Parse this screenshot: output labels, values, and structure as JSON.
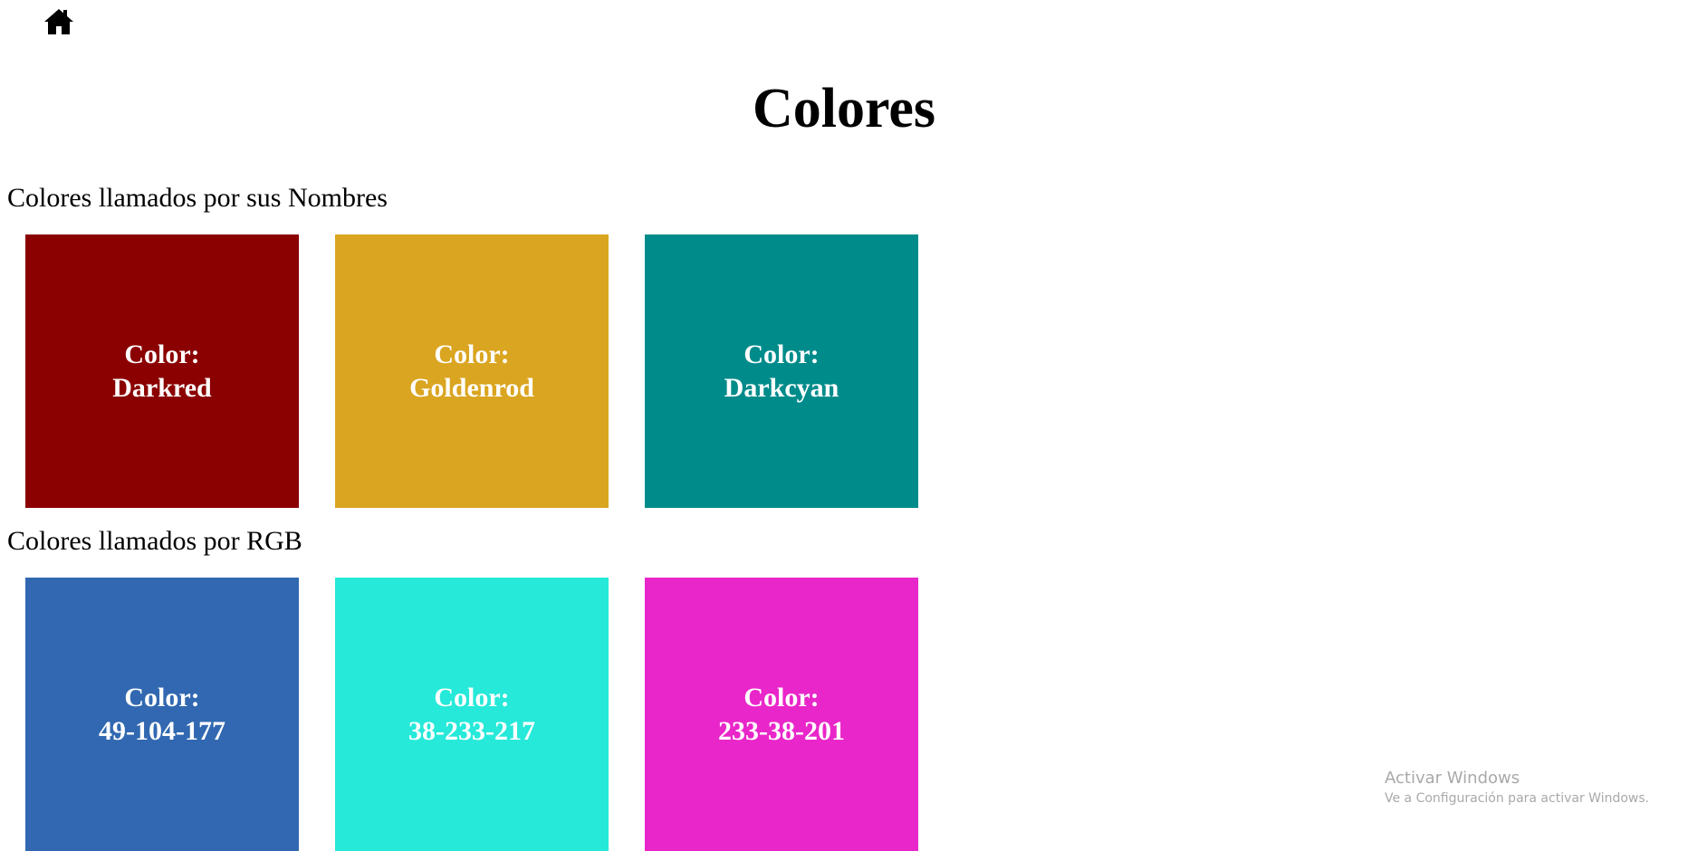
{
  "nav": {
    "home_icon": "home-icon"
  },
  "page": {
    "title": "Colores"
  },
  "sections": [
    {
      "title": "Colores llamados por sus Nombres",
      "swatches": [
        {
          "prefix": "Color:",
          "name": "Darkred",
          "color": "#8b0000"
        },
        {
          "prefix": "Color:",
          "name": "Goldenrod",
          "color": "#daa520"
        },
        {
          "prefix": "Color:",
          "name": "Darkcyan",
          "color": "#008b8b"
        }
      ]
    },
    {
      "title": "Colores llamados por RGB",
      "swatches": [
        {
          "prefix": "Color:",
          "name": "49-104-177",
          "color": "#3168b1"
        },
        {
          "prefix": "Color:",
          "name": "38-233-217",
          "color": "#26e9d9"
        },
        {
          "prefix": "Color:",
          "name": "233-38-201",
          "color": "#e926c9"
        }
      ]
    }
  ],
  "watermark": {
    "title": "Activar Windows",
    "subtitle": "Ve a Configuración para activar Windows."
  }
}
